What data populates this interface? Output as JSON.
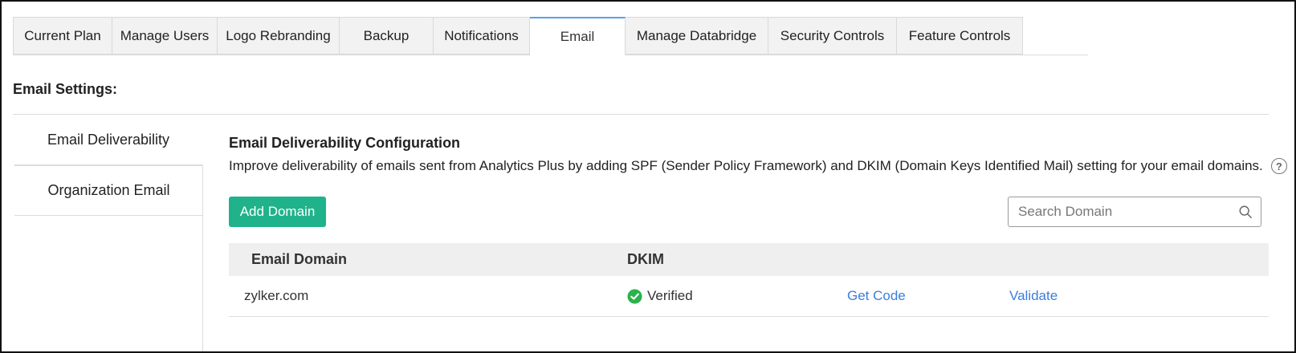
{
  "tabs": [
    {
      "label": "Current Plan",
      "width": 124
    },
    {
      "label": "Manage Users",
      "width": 131
    },
    {
      "label": "Logo Rebranding",
      "width": 157
    },
    {
      "label": "Backup",
      "width": 120
    },
    {
      "label": "Notifications",
      "width": 120
    },
    {
      "label": "Email",
      "width": 120,
      "active": true
    },
    {
      "label": "Manage Databridge",
      "width": 179
    },
    {
      "label": "Security Controls",
      "width": 161
    },
    {
      "label": "Feature Controls",
      "width": 157
    }
  ],
  "section_title": "Email Settings:",
  "sidenav": {
    "items": [
      {
        "label": "Email Deliverability",
        "active": true
      },
      {
        "label": "Organization Email"
      }
    ]
  },
  "main": {
    "title": "Email Deliverability Configuration",
    "description": "Improve deliverability of emails sent from Analytics Plus by adding SPF (Sender Policy Framework) and DKIM (Domain Keys Identified Mail) setting for your email domains.",
    "help_icon": "?",
    "add_button": "Add Domain",
    "search_placeholder": "Search Domain"
  },
  "table": {
    "headers": {
      "domain": "Email Domain",
      "dkim": "DKIM"
    },
    "rows": [
      {
        "domain": "zylker.com",
        "dkim_status": "Verified",
        "get_code": "Get Code",
        "validate": "Validate"
      }
    ]
  },
  "colors": {
    "accent": "#20b38b",
    "link": "#3b7ddd",
    "active_tab_border": "#5aa0e6",
    "verified": "#2bb24c"
  },
  "icons": {
    "search": "search-icon",
    "verified": "check-circle-icon",
    "help": "help-icon"
  }
}
